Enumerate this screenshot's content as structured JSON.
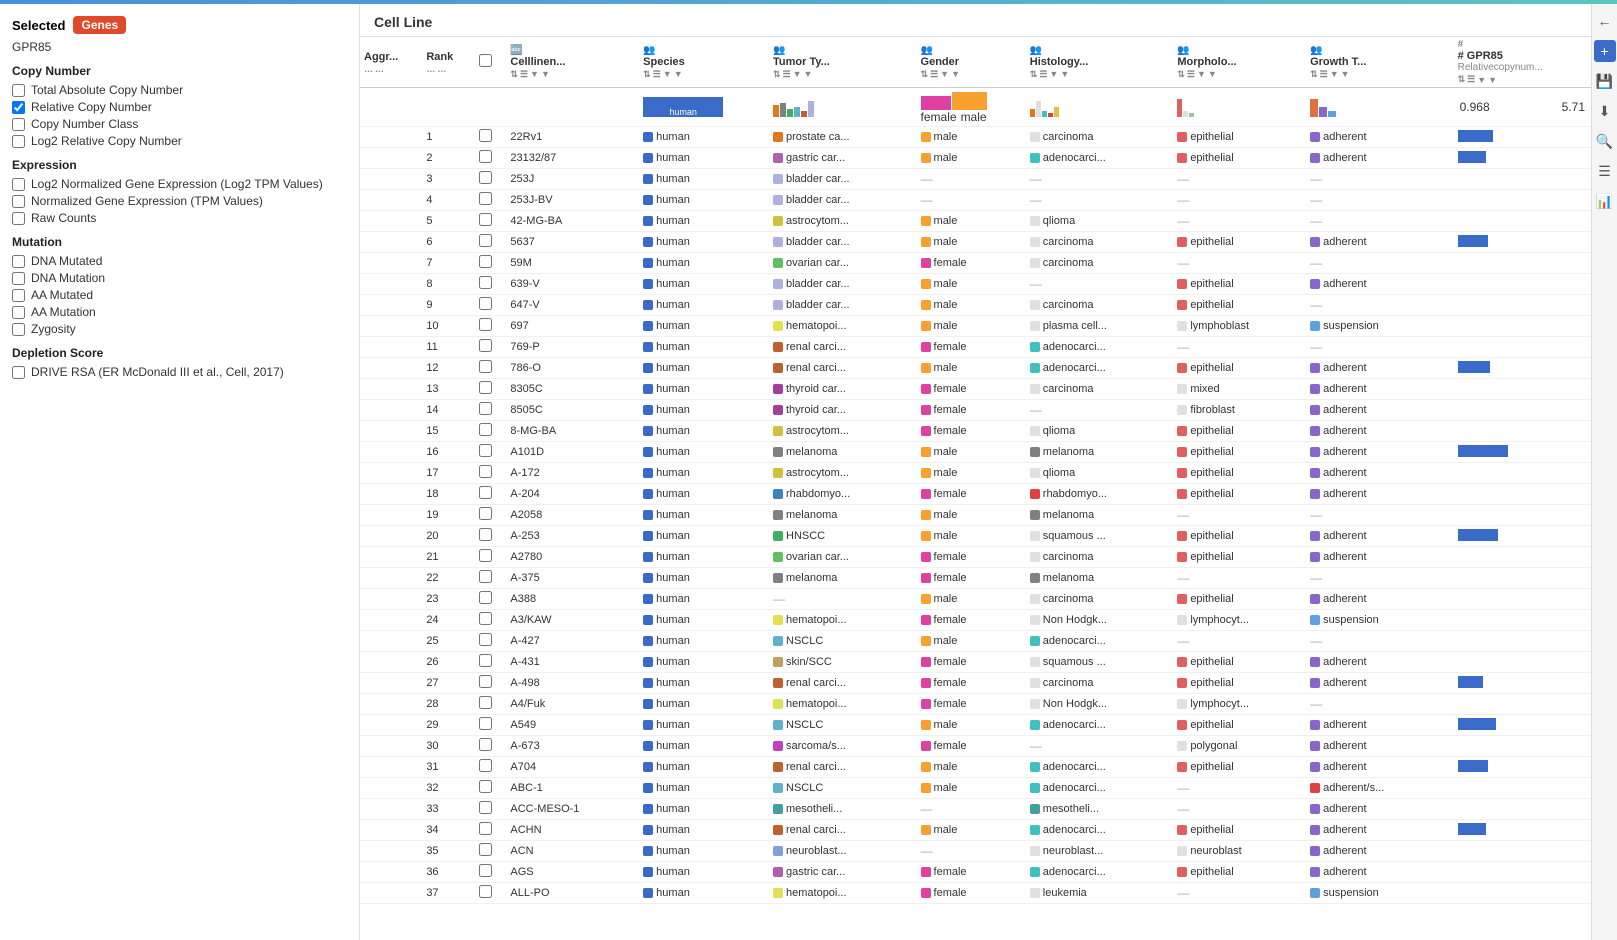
{
  "topbar": {},
  "sidebar": {
    "selected_label": "Selected",
    "genes_badge": "Genes",
    "gene_name": "GPR85",
    "copy_number": {
      "title": "Copy Number",
      "options": [
        {
          "label": "Total Absolute Copy Number",
          "checked": false
        },
        {
          "label": "Relative Copy Number",
          "checked": true
        },
        {
          "label": "Copy Number Class",
          "checked": false
        },
        {
          "label": "Log2 Relative Copy Number",
          "checked": false
        }
      ]
    },
    "expression": {
      "title": "Expression",
      "options": [
        {
          "label": "Log2 Normalized Gene Expression (Log2 TPM Values)",
          "checked": false
        },
        {
          "label": "Normalized Gene Expression (TPM Values)",
          "checked": false
        },
        {
          "label": "Raw Counts",
          "checked": false
        }
      ]
    },
    "mutation": {
      "title": "Mutation",
      "options": [
        {
          "label": "DNA Mutated",
          "checked": false
        },
        {
          "label": "DNA Mutation",
          "checked": false
        },
        {
          "label": "AA Mutated",
          "checked": false
        },
        {
          "label": "AA Mutation",
          "checked": false
        },
        {
          "label": "Zygosity",
          "checked": false
        }
      ]
    },
    "depletion": {
      "title": "Depletion Score",
      "options": [
        {
          "label": "DRIVE RSA (ER McDonald III et al., Cell, 2017)",
          "checked": false
        }
      ]
    }
  },
  "main": {
    "title": "Cell Line",
    "columns": {
      "aggr": "Aggr...",
      "rank": "Rank",
      "cellline": "Celllinen...",
      "species": "Species",
      "tumor_type": "Tumor Ty...",
      "gender": "Gender",
      "histology": "Histology...",
      "morphology": "Morpholo...",
      "growth_type": "Growth T...",
      "gpr85": "# GPR85",
      "gpr85_sub": "Relativecopynum..."
    },
    "gpr85_range": {
      "min": "0.968",
      "max": "5.71"
    },
    "rows": [
      {
        "rank": 1,
        "name": "22Rv1",
        "species": "human",
        "species_color": "#3b6bc9",
        "tumor": "prostate ca...",
        "tumor_color": "#e07820",
        "gender": "male",
        "gender_color": "#f8a030",
        "histology": "carcinoma",
        "histology_color": "#e0e0e0",
        "morphology": "epithelial",
        "morphology_color": "#e06060",
        "growth": "adherent",
        "growth_color": "#8866cc",
        "bar": 35
      },
      {
        "rank": 2,
        "name": "23132/87",
        "species": "human",
        "species_color": "#3b6bc9",
        "tumor": "gastric car...",
        "tumor_color": "#b060b0",
        "gender": "male",
        "gender_color": "#f8a030",
        "histology": "adenocarci...",
        "histology_color": "#40c0c0",
        "morphology": "epithelial",
        "morphology_color": "#e06060",
        "growth": "adherent",
        "growth_color": "#8866cc",
        "bar": 28
      },
      {
        "rank": 3,
        "name": "253J",
        "species": "human",
        "species_color": "#3b6bc9",
        "tumor": "bladder car...",
        "tumor_color": "#b0b0e0",
        "gender": "",
        "gender_color": "",
        "histology": "",
        "histology_color": "",
        "morphology": "",
        "morphology_color": "",
        "growth": "",
        "growth_color": "",
        "bar": 0
      },
      {
        "rank": 4,
        "name": "253J-BV",
        "species": "human",
        "species_color": "#3b6bc9",
        "tumor": "bladder car...",
        "tumor_color": "#b0b0e0",
        "gender": "",
        "gender_color": "",
        "histology": "",
        "histology_color": "",
        "morphology": "",
        "morphology_color": "",
        "growth": "",
        "growth_color": "",
        "bar": 0
      },
      {
        "rank": 5,
        "name": "42-MG-BA",
        "species": "human",
        "species_color": "#3b6bc9",
        "tumor": "astrocytom...",
        "tumor_color": "#d0c040",
        "gender": "male",
        "gender_color": "#f8a030",
        "histology": "qlioma",
        "histology_color": "#e0e0e0",
        "morphology": "",
        "morphology_color": "",
        "growth": "",
        "growth_color": "",
        "bar": 0
      },
      {
        "rank": 6,
        "name": "5637",
        "species": "human",
        "species_color": "#3b6bc9",
        "tumor": "bladder car...",
        "tumor_color": "#b0b0e0",
        "gender": "male",
        "gender_color": "#f8a030",
        "histology": "carcinoma",
        "histology_color": "#e0e0e0",
        "morphology": "epithelial",
        "morphology_color": "#e06060",
        "growth": "adherent",
        "growth_color": "#8866cc",
        "bar": 30
      },
      {
        "rank": 7,
        "name": "59M",
        "species": "human",
        "species_color": "#3b6bc9",
        "tumor": "ovarian car...",
        "tumor_color": "#60c060",
        "gender": "female",
        "gender_color": "#e040a0",
        "histology": "carcinoma",
        "histology_color": "#e0e0e0",
        "morphology": "",
        "morphology_color": "",
        "growth": "",
        "growth_color": "",
        "bar": 0
      },
      {
        "rank": 8,
        "name": "639-V",
        "species": "human",
        "species_color": "#3b6bc9",
        "tumor": "bladder car...",
        "tumor_color": "#b0b0e0",
        "gender": "male",
        "gender_color": "#f8a030",
        "histology": "",
        "histology_color": "",
        "morphology": "epithelial",
        "morphology_color": "#e06060",
        "growth": "adherent",
        "growth_color": "#8866cc",
        "bar": 0
      },
      {
        "rank": 9,
        "name": "647-V",
        "species": "human",
        "species_color": "#3b6bc9",
        "tumor": "bladder car...",
        "tumor_color": "#b0b0e0",
        "gender": "male",
        "gender_color": "#f8a030",
        "histology": "carcinoma",
        "histology_color": "#e0e0e0",
        "morphology": "epithelial",
        "morphology_color": "#e06060",
        "growth": "",
        "growth_color": "",
        "bar": 0
      },
      {
        "rank": 10,
        "name": "697",
        "species": "human",
        "species_color": "#3b6bc9",
        "tumor": "hematopoi...",
        "tumor_color": "#e0e050",
        "gender": "male",
        "gender_color": "#f8a030",
        "histology": "plasma cell...",
        "histology_color": "#e0e0e0",
        "morphology": "lymphoblast",
        "morphology_color": "#e0e0e0",
        "growth": "suspension",
        "growth_color": "#60a0e0",
        "bar": 0
      },
      {
        "rank": 11,
        "name": "769-P",
        "species": "human",
        "species_color": "#3b6bc9",
        "tumor": "renal carci...",
        "tumor_color": "#c06030",
        "gender": "female",
        "gender_color": "#e040a0",
        "histology": "adenocarci...",
        "histology_color": "#40c0c0",
        "morphology": "",
        "morphology_color": "",
        "growth": "",
        "growth_color": "",
        "bar": 0
      },
      {
        "rank": 12,
        "name": "786-O",
        "species": "human",
        "species_color": "#3b6bc9",
        "tumor": "renal carci...",
        "tumor_color": "#c06030",
        "gender": "male",
        "gender_color": "#f8a030",
        "histology": "adenocarci...",
        "histology_color": "#40c0c0",
        "morphology": "epithelial",
        "morphology_color": "#e06060",
        "growth": "adherent",
        "growth_color": "#8866cc",
        "bar": 32
      },
      {
        "rank": 13,
        "name": "8305C",
        "species": "human",
        "species_color": "#3b6bc9",
        "tumor": "thyroid car...",
        "tumor_color": "#a040a0",
        "gender": "female",
        "gender_color": "#e040a0",
        "histology": "carcinoma",
        "histology_color": "#e0e0e0",
        "morphology": "mixed",
        "morphology_color": "#e0e0e0",
        "growth": "adherent",
        "growth_color": "#8866cc",
        "bar": 0
      },
      {
        "rank": 14,
        "name": "8505C",
        "species": "human",
        "species_color": "#3b6bc9",
        "tumor": "thyroid car...",
        "tumor_color": "#a040a0",
        "gender": "female",
        "gender_color": "#e040a0",
        "histology": "",
        "histology_color": "",
        "morphology": "fibroblast",
        "morphology_color": "#e0e0e0",
        "growth": "adherent",
        "growth_color": "#8866cc",
        "bar": 0
      },
      {
        "rank": 15,
        "name": "8-MG-BA",
        "species": "human",
        "species_color": "#3b6bc9",
        "tumor": "astrocytom...",
        "tumor_color": "#d0c040",
        "gender": "female",
        "gender_color": "#e040a0",
        "histology": "qlioma",
        "histology_color": "#e0e0e0",
        "morphology": "epithelial",
        "morphology_color": "#e06060",
        "growth": "adherent",
        "growth_color": "#8866cc",
        "bar": 0
      },
      {
        "rank": 16,
        "name": "A101D",
        "species": "human",
        "species_color": "#3b6bc9",
        "tumor": "melanoma",
        "tumor_color": "#808080",
        "gender": "male",
        "gender_color": "#f8a030",
        "histology": "melanoma",
        "histology_color": "#808080",
        "morphology": "epithelial",
        "morphology_color": "#e06060",
        "growth": "adherent",
        "growth_color": "#8866cc",
        "bar": 50
      },
      {
        "rank": 17,
        "name": "A-172",
        "species": "human",
        "species_color": "#3b6bc9",
        "tumor": "astrocytom...",
        "tumor_color": "#d0c040",
        "gender": "male",
        "gender_color": "#f8a030",
        "histology": "qlioma",
        "histology_color": "#e0e0e0",
        "morphology": "epithelial",
        "morphology_color": "#e06060",
        "growth": "adherent",
        "growth_color": "#8866cc",
        "bar": 0
      },
      {
        "rank": 18,
        "name": "A-204",
        "species": "human",
        "species_color": "#3b6bc9",
        "tumor": "rhabdomyo...",
        "tumor_color": "#4080c0",
        "gender": "female",
        "gender_color": "#e040a0",
        "histology": "rhabdomyo...",
        "histology_color": "#e04040",
        "morphology": "epithelial",
        "morphology_color": "#e06060",
        "growth": "adherent",
        "growth_color": "#8866cc",
        "bar": 0
      },
      {
        "rank": 19,
        "name": "A2058",
        "species": "human",
        "species_color": "#3b6bc9",
        "tumor": "melanoma",
        "tumor_color": "#808080",
        "gender": "male",
        "gender_color": "#f8a030",
        "histology": "melanoma",
        "histology_color": "#808080",
        "morphology": "",
        "morphology_color": "",
        "growth": "",
        "growth_color": "",
        "bar": 0
      },
      {
        "rank": 20,
        "name": "A-253",
        "species": "human",
        "species_color": "#3b6bc9",
        "tumor": "HNSCC",
        "tumor_color": "#40b060",
        "gender": "male",
        "gender_color": "#f8a030",
        "histology": "squamous ...",
        "histology_color": "#e0e0e0",
        "morphology": "epithelial",
        "morphology_color": "#e06060",
        "growth": "adherent",
        "growth_color": "#8866cc",
        "bar": 40
      },
      {
        "rank": 21,
        "name": "A2780",
        "species": "human",
        "species_color": "#3b6bc9",
        "tumor": "ovarian car...",
        "tumor_color": "#60c060",
        "gender": "female",
        "gender_color": "#e040a0",
        "histology": "carcinoma",
        "histology_color": "#e0e0e0",
        "morphology": "epithelial",
        "morphology_color": "#e06060",
        "growth": "adherent",
        "growth_color": "#8866cc",
        "bar": 0
      },
      {
        "rank": 22,
        "name": "A-375",
        "species": "human",
        "species_color": "#3b6bc9",
        "tumor": "melanoma",
        "tumor_color": "#808080",
        "gender": "female",
        "gender_color": "#e040a0",
        "histology": "melanoma",
        "histology_color": "#808080",
        "morphology": "",
        "morphology_color": "",
        "growth": "",
        "growth_color": "",
        "bar": 0
      },
      {
        "rank": 23,
        "name": "A388",
        "species": "human",
        "species_color": "#3b6bc9",
        "tumor": "",
        "tumor_color": "",
        "gender": "male",
        "gender_color": "#f8a030",
        "histology": "carcinoma",
        "histology_color": "#e0e0e0",
        "morphology": "epithelial",
        "morphology_color": "#e06060",
        "growth": "adherent",
        "growth_color": "#8866cc",
        "bar": 0
      },
      {
        "rank": 24,
        "name": "A3/KAW",
        "species": "human",
        "species_color": "#3b6bc9",
        "tumor": "hematopoi...",
        "tumor_color": "#e0e050",
        "gender": "female",
        "gender_color": "#e040a0",
        "histology": "Non Hodgk...",
        "histology_color": "#e0e0e0",
        "morphology": "lymphocyt...",
        "morphology_color": "#e0e0e0",
        "growth": "suspension",
        "growth_color": "#60a0e0",
        "bar": 0
      },
      {
        "rank": 25,
        "name": "A-427",
        "species": "human",
        "species_color": "#3b6bc9",
        "tumor": "NSCLC",
        "tumor_color": "#60b0d0",
        "gender": "male",
        "gender_color": "#f8a030",
        "histology": "adenocarci...",
        "histology_color": "#40c0c0",
        "morphology": "",
        "morphology_color": "",
        "growth": "",
        "growth_color": "",
        "bar": 0
      },
      {
        "rank": 26,
        "name": "A-431",
        "species": "human",
        "species_color": "#3b6bc9",
        "tumor": "skin/SCC",
        "tumor_color": "#c0a060",
        "gender": "female",
        "gender_color": "#e040a0",
        "histology": "squamous ...",
        "histology_color": "#e0e0e0",
        "morphology": "epithelial",
        "morphology_color": "#e06060",
        "growth": "adherent",
        "growth_color": "#8866cc",
        "bar": 0
      },
      {
        "rank": 27,
        "name": "A-498",
        "species": "human",
        "species_color": "#3b6bc9",
        "tumor": "renal carci...",
        "tumor_color": "#c06030",
        "gender": "female",
        "gender_color": "#e040a0",
        "histology": "carcinoma",
        "histology_color": "#e0e0e0",
        "morphology": "epithelial",
        "morphology_color": "#e06060",
        "growth": "adherent",
        "growth_color": "#8866cc",
        "bar": 25
      },
      {
        "rank": 28,
        "name": "A4/Fuk",
        "species": "human",
        "species_color": "#3b6bc9",
        "tumor": "hematopoi...",
        "tumor_color": "#e0e050",
        "gender": "female",
        "gender_color": "#e040a0",
        "histology": "Non Hodgk...",
        "histology_color": "#e0e0e0",
        "morphology": "lymphocyt...",
        "morphology_color": "#e0e0e0",
        "growth": "",
        "growth_color": "",
        "bar": 0
      },
      {
        "rank": 29,
        "name": "A549",
        "species": "human",
        "species_color": "#3b6bc9",
        "tumor": "NSCLC",
        "tumor_color": "#60b0d0",
        "gender": "male",
        "gender_color": "#f8a030",
        "histology": "adenocarci...",
        "histology_color": "#40c0c0",
        "morphology": "epithelial",
        "morphology_color": "#e06060",
        "growth": "adherent",
        "growth_color": "#8866cc",
        "bar": 38
      },
      {
        "rank": 30,
        "name": "A-673",
        "species": "human",
        "species_color": "#3b6bc9",
        "tumor": "sarcoma/s...",
        "tumor_color": "#c040c0",
        "gender": "female",
        "gender_color": "#e040a0",
        "histology": "",
        "histology_color": "",
        "morphology": "polygonal",
        "morphology_color": "#e0e0e0",
        "growth": "adherent",
        "growth_color": "#8866cc",
        "bar": 0
      },
      {
        "rank": 31,
        "name": "A704",
        "species": "human",
        "species_color": "#3b6bc9",
        "tumor": "renal carci...",
        "tumor_color": "#c06030",
        "gender": "male",
        "gender_color": "#f8a030",
        "histology": "adenocarci...",
        "histology_color": "#40c0c0",
        "morphology": "epithelial",
        "morphology_color": "#e06060",
        "growth": "adherent",
        "growth_color": "#8866cc",
        "bar": 30
      },
      {
        "rank": 32,
        "name": "ABC-1",
        "species": "human",
        "species_color": "#3b6bc9",
        "tumor": "NSCLC",
        "tumor_color": "#60b0d0",
        "gender": "male",
        "gender_color": "#f8a030",
        "histology": "adenocarci...",
        "histology_color": "#40c0c0",
        "morphology": "",
        "morphology_color": "",
        "growth": "adherent/s...",
        "growth_color": "#e04040",
        "bar": 0
      },
      {
        "rank": 33,
        "name": "ACC-MESO-1",
        "species": "human",
        "species_color": "#3b6bc9",
        "tumor": "mesotheli...",
        "tumor_color": "#40a0a0",
        "gender": "",
        "gender_color": "",
        "histology": "mesotheli...",
        "histology_color": "#40a0a0",
        "morphology": "",
        "morphology_color": "",
        "growth": "adherent",
        "growth_color": "#8866cc",
        "bar": 0
      },
      {
        "rank": 34,
        "name": "ACHN",
        "species": "human",
        "species_color": "#3b6bc9",
        "tumor": "renal carci...",
        "tumor_color": "#c06030",
        "gender": "male",
        "gender_color": "#f8a030",
        "histology": "adenocarci...",
        "histology_color": "#40c0c0",
        "morphology": "epithelial",
        "morphology_color": "#e06060",
        "growth": "adherent",
        "growth_color": "#8866cc",
        "bar": 28
      },
      {
        "rank": 35,
        "name": "ACN",
        "species": "human",
        "species_color": "#3b6bc9",
        "tumor": "neuroblast...",
        "tumor_color": "#80a0e0",
        "gender": "",
        "gender_color": "",
        "histology": "neuroblast...",
        "histology_color": "#e0e0e0",
        "morphology": "neuroblast",
        "morphology_color": "#e0e0e0",
        "growth": "adherent",
        "growth_color": "#8866cc",
        "bar": 0
      },
      {
        "rank": 36,
        "name": "AGS",
        "species": "human",
        "species_color": "#3b6bc9",
        "tumor": "gastric car...",
        "tumor_color": "#b060b0",
        "gender": "female",
        "gender_color": "#e040a0",
        "histology": "adenocarci...",
        "histology_color": "#40c0c0",
        "morphology": "epithelial",
        "morphology_color": "#e06060",
        "growth": "adherent",
        "growth_color": "#8866cc",
        "bar": 0
      },
      {
        "rank": 37,
        "name": "ALL-PO",
        "species": "human",
        "species_color": "#3b6bc9",
        "tumor": "hematopoi...",
        "tumor_color": "#e0e050",
        "gender": "female",
        "gender_color": "#e040a0",
        "histology": "leukemia",
        "histology_color": "#e0e0e0",
        "morphology": "",
        "morphology_color": "",
        "growth": "suspension",
        "growth_color": "#60a0e0",
        "bar": 0
      }
    ]
  },
  "right_panel": {
    "icons": [
      "←",
      "+",
      "💾",
      "⬇",
      "🔍",
      "☰",
      "📊"
    ]
  }
}
